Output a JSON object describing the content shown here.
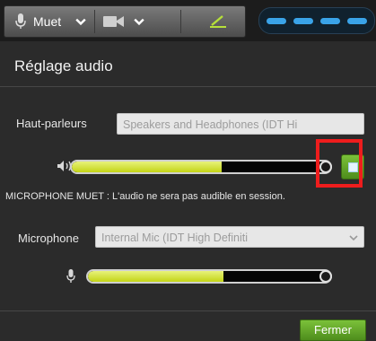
{
  "toolbar": {
    "mute_label": "Muet",
    "mic_icon": "microphone-icon",
    "camera_icon": "camera-icon",
    "edit_icon": "pencil-icon"
  },
  "panel": {
    "title": "Réglage audio",
    "speakers": {
      "label": "Haut-parleurs",
      "value": "Speakers and Headphones (IDT Hi",
      "level": 0.58
    },
    "mute_notice": "MICROPHONE MUET : L'audio ne sera pas audible en session.",
    "microphone": {
      "label": "Microphone",
      "value": "Internal Mic (IDT High Definiti",
      "level": 0.56
    },
    "close_label": "Fermer"
  },
  "colors": {
    "accent_green": "#5a9d22",
    "highlight_red": "#ee1d1d",
    "level_fill": "#d0df2e",
    "status_blue": "#3aa3e8"
  }
}
